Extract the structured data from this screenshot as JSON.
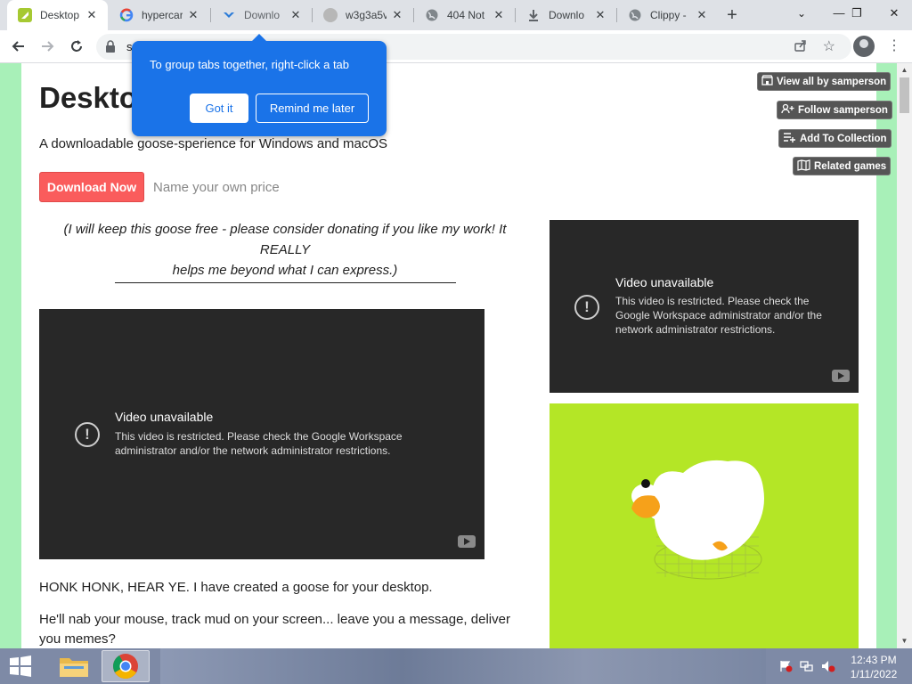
{
  "browser": {
    "tabs": [
      {
        "title": "Desktop",
        "favicon": "itch-icon",
        "active": true
      },
      {
        "title": "hypercar",
        "favicon": "google-icon",
        "active": false
      },
      {
        "title": "Downlo",
        "favicon": "download-icon",
        "active": false
      },
      {
        "title": "w3g3a5v",
        "favicon": "generic-icon",
        "active": false
      },
      {
        "title": "404 Not",
        "favicon": "globe-icon",
        "active": false
      },
      {
        "title": "Downlo",
        "favicon": "download-arrow-icon",
        "active": false
      },
      {
        "title": "Clippy - ",
        "favicon": "globe-icon",
        "active": false
      }
    ],
    "address": "s",
    "window_controls": {
      "minimize": "—",
      "restore": "❐",
      "close": "✕"
    }
  },
  "popup": {
    "message": "To group tabs together, right-click a tab",
    "primary_button": "Got it",
    "secondary_button": "Remind me later"
  },
  "page": {
    "title": "Deskto",
    "tagline": "A downloadable goose-sperience for Windows and macOS",
    "download_button": "Download Now",
    "price_placeholder": "Name your own price",
    "side_buttons": {
      "view_all": "View all by samperson",
      "follow": "Follow samperson",
      "add_collection": "Add To Collection",
      "related": "Related games"
    },
    "donate_line1": "(I will keep this goose free - please consider donating if you like my work! It REALLY",
    "donate_line2": "helps me beyond what I can express.)",
    "video_left": {
      "title": "Video unavailable",
      "line1": "This video is restricted. Please check the Google Workspace",
      "line2": "administrator and/or the network administrator restrictions."
    },
    "video_right": {
      "title": "Video unavailable",
      "line1": "This video is restricted. Please check the",
      "line2": "Google Workspace administrator and/or the",
      "line3": "network administrator restrictions."
    },
    "para1": "HONK HONK, HEAR YE. I have created a goose for your desktop.",
    "para2_line1": "He'll nab your mouse, track mud on your screen...  leave you a message, deliver",
    "para2_line2": "you memes?"
  },
  "taskbar": {
    "time": "12:43 PM",
    "date": "1/11/2022"
  },
  "colors": {
    "page_bg": "#a8f0b8",
    "download_button": "#fa5c5c",
    "popup": "#1a73e8",
    "goose_bg": "#b4e626"
  }
}
